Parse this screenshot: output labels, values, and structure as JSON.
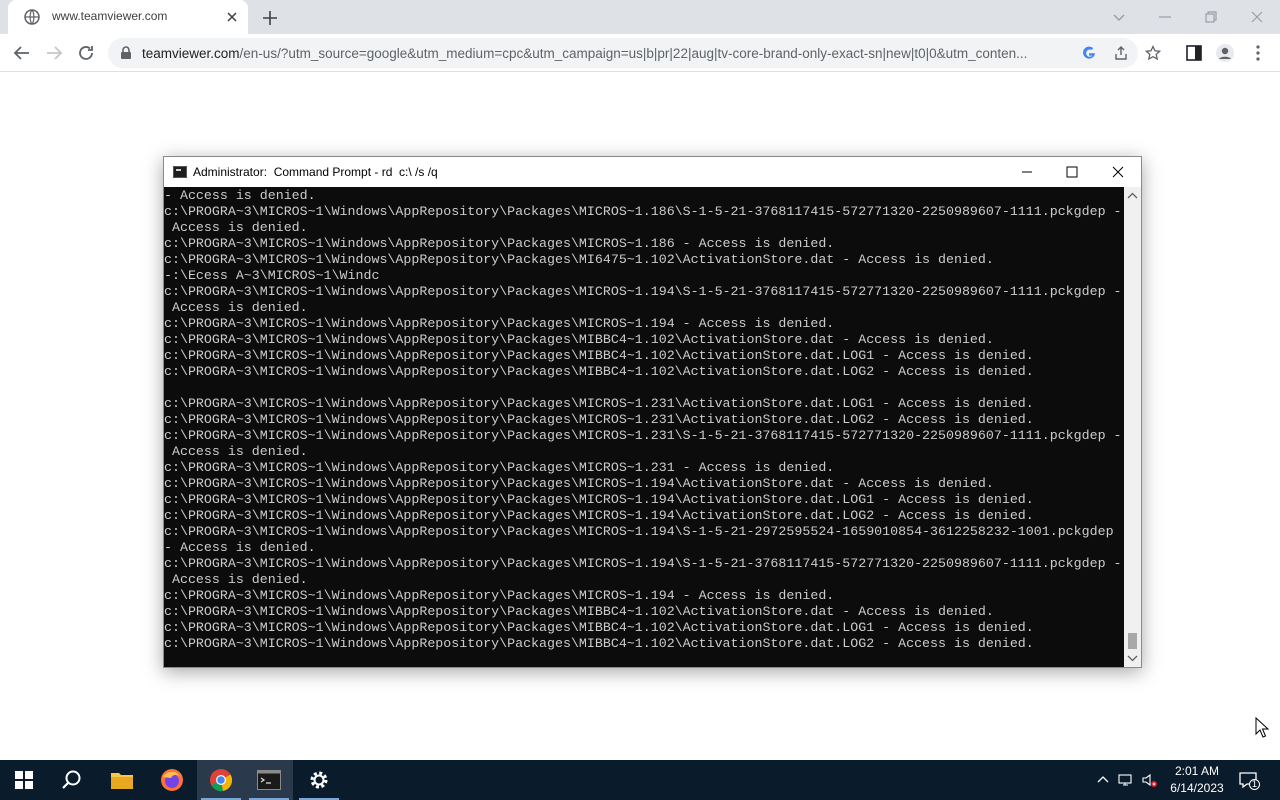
{
  "browser": {
    "tab_title": "www.teamviewer.com",
    "url_host": "teamviewer.com",
    "url_path": "/en-us/?utm_source=google&utm_medium=cpc&utm_campaign=us|b|pr|22|aug|tv-core-brand-only-exact-sn|new|t0|0&utm_conten..."
  },
  "cmd": {
    "title": "Administrator:  Command Prompt - rd  c:\\ /s /q",
    "lines": [
      "- Access is denied.",
      "c:\\PROGRA~3\\MICROS~1\\Windows\\AppRepository\\Packages\\MICROS~1.186\\S-1-5-21-3768117415-572771320-2250989607-1111.pckgdep -",
      " Access is denied.",
      "c:\\PROGRA~3\\MICROS~1\\Windows\\AppRepository\\Packages\\MICROS~1.186 - Access is denied.",
      "c:\\PROGRA~3\\MICROS~1\\Windows\\AppRepository\\Packages\\MI6475~1.102\\ActivationStore.dat - Access is denied.",
      "-:\\Ecess A~3\\MICROS~1\\Windc",
      "c:\\PROGRA~3\\MICROS~1\\Windows\\AppRepository\\Packages\\MICROS~1.194\\S-1-5-21-3768117415-572771320-2250989607-1111.pckgdep -",
      " Access is denied.",
      "c:\\PROGRA~3\\MICROS~1\\Windows\\AppRepository\\Packages\\MICROS~1.194 - Access is denied.",
      "c:\\PROGRA~3\\MICROS~1\\Windows\\AppRepository\\Packages\\MIBBC4~1.102\\ActivationStore.dat - Access is denied.",
      "c:\\PROGRA~3\\MICROS~1\\Windows\\AppRepository\\Packages\\MIBBC4~1.102\\ActivationStore.dat.LOG1 - Access is denied.",
      "c:\\PROGRA~3\\MICROS~1\\Windows\\AppRepository\\Packages\\MIBBC4~1.102\\ActivationStore.dat.LOG2 - Access is denied.",
      "",
      "c:\\PROGRA~3\\MICROS~1\\Windows\\AppRepository\\Packages\\MICROS~1.231\\ActivationStore.dat.LOG1 - Access is denied.",
      "c:\\PROGRA~3\\MICROS~1\\Windows\\AppRepository\\Packages\\MICROS~1.231\\ActivationStore.dat.LOG2 - Access is denied.",
      "c:\\PROGRA~3\\MICROS~1\\Windows\\AppRepository\\Packages\\MICROS~1.231\\S-1-5-21-3768117415-572771320-2250989607-1111.pckgdep -",
      " Access is denied.",
      "c:\\PROGRA~3\\MICROS~1\\Windows\\AppRepository\\Packages\\MICROS~1.231 - Access is denied.",
      "c:\\PROGRA~3\\MICROS~1\\Windows\\AppRepository\\Packages\\MICROS~1.194\\ActivationStore.dat - Access is denied.",
      "c:\\PROGRA~3\\MICROS~1\\Windows\\AppRepository\\Packages\\MICROS~1.194\\ActivationStore.dat.LOG1 - Access is denied.",
      "c:\\PROGRA~3\\MICROS~1\\Windows\\AppRepository\\Packages\\MICROS~1.194\\ActivationStore.dat.LOG2 - Access is denied.",
      "c:\\PROGRA~3\\MICROS~1\\Windows\\AppRepository\\Packages\\MICROS~1.194\\S-1-5-21-2972595524-1659010854-3612258232-1001.pckgdep",
      "- Access is denied.",
      "c:\\PROGRA~3\\MICROS~1\\Windows\\AppRepository\\Packages\\MICROS~1.194\\S-1-5-21-3768117415-572771320-2250989607-1111.pckgdep -",
      " Access is denied.",
      "c:\\PROGRA~3\\MICROS~1\\Windows\\AppRepository\\Packages\\MICROS~1.194 - Access is denied.",
      "c:\\PROGRA~3\\MICROS~1\\Windows\\AppRepository\\Packages\\MIBBC4~1.102\\ActivationStore.dat - Access is denied.",
      "c:\\PROGRA~3\\MICROS~1\\Windows\\AppRepository\\Packages\\MIBBC4~1.102\\ActivationStore.dat.LOG1 - Access is denied.",
      "c:\\PROGRA~3\\MICROS~1\\Windows\\AppRepository\\Packages\\MIBBC4~1.102\\ActivationStore.dat.LOG2 - Access is denied."
    ]
  },
  "taskbar": {
    "time": "2:01 AM",
    "date": "6/14/2023",
    "notification_count": "1"
  },
  "colors": {
    "console_bg": "#0c0c0c",
    "console_text": "#cccccc",
    "taskbar_bg": "#0a1b2c"
  }
}
